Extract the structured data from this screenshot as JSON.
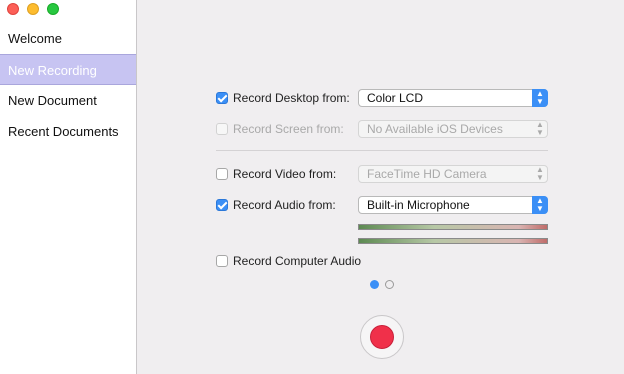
{
  "window": {
    "controls": [
      "close",
      "minimize",
      "maximize"
    ]
  },
  "sidebar": {
    "items": [
      {
        "label": "Welcome",
        "selected": false
      },
      {
        "label": "New Recording",
        "selected": true
      },
      {
        "label": "New Document",
        "selected": false
      },
      {
        "label": "Recent Documents",
        "selected": false
      }
    ]
  },
  "options": {
    "record_desktop": {
      "label": "Record Desktop from:",
      "checked": true,
      "value": "Color LCD"
    },
    "record_screen": {
      "label": "Record Screen from:",
      "checked": false,
      "disabled": true,
      "value": "No Available iOS Devices"
    },
    "record_video": {
      "label": "Record Video from:",
      "checked": false,
      "value": "FaceTime HD Camera"
    },
    "record_audio": {
      "label": "Record Audio from:",
      "checked": true,
      "value": "Built-in Microphone"
    },
    "record_computer_audio": {
      "label": "Record Computer Audio",
      "checked": false
    }
  },
  "pager": {
    "pages": 2,
    "current": 1
  },
  "colors": {
    "accent": "#3b8ff6",
    "record": "#f0304a",
    "selection": "#c7c4f2"
  }
}
